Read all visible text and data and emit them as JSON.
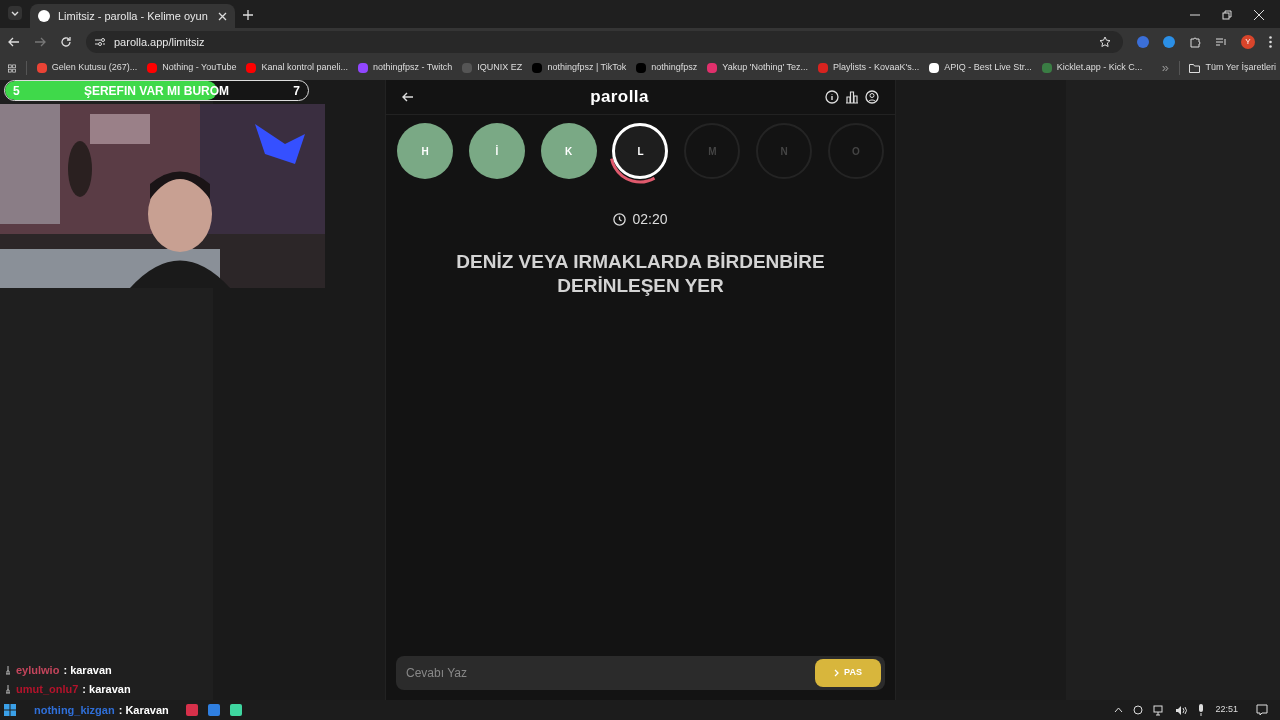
{
  "browser": {
    "tab": {
      "title": "Limitsiz - parolla - Kelime oyun",
      "selected": true
    },
    "address": "parolla.app/limitsiz",
    "bookmarks": [
      {
        "label": "Gelen Kutusu (267)...",
        "color": "#ea4335"
      },
      {
        "label": "Nothing - YouTube",
        "color": "#ff0000"
      },
      {
        "label": "Kanal kontrol paneli...",
        "color": "#ff0000"
      },
      {
        "label": "nothingfpsz - Twitch",
        "color": "#9146ff"
      },
      {
        "label": "IQUNIX EZ",
        "color": "#555555"
      },
      {
        "label": "nothingfpsz | TikTok",
        "color": "#000000"
      },
      {
        "label": "nothingfpsz",
        "color": "#000000"
      },
      {
        "label": "Yakup 'Nothing' Tez...",
        "color": "#e1306c"
      },
      {
        "label": "Playlists - KovaaK's...",
        "color": "#d8231f"
      },
      {
        "label": "APIQ - Best Live Str...",
        "color": "#ffffff"
      },
      {
        "label": "Kicklet.app - Kick C...",
        "color": "#3a7d44"
      }
    ],
    "all_bookmarks": "Tüm Yer İşaretleri",
    "profile": "Y"
  },
  "goal_bar": {
    "start": "5",
    "title": "ŞEREFIN VAR MI BUROM",
    "end": "7",
    "level": 0.7
  },
  "game": {
    "title": "parolla",
    "letters": [
      {
        "letter": "H",
        "kind": "correct"
      },
      {
        "letter": "İ",
        "kind": "correct"
      },
      {
        "letter": "K",
        "kind": "correct"
      },
      {
        "letter": "L",
        "kind": "current"
      },
      {
        "letter": "M",
        "kind": "pending"
      },
      {
        "letter": "N",
        "kind": "pending"
      },
      {
        "letter": "O",
        "kind": "pending"
      }
    ],
    "timer": "02:20",
    "question": "DENİZ VEYA IRMAKLARDA BİRDENBİRE DERİNLEŞEN YER",
    "answer": {
      "placeholder": "Cevabı Yaz"
    },
    "pass_button": "PAS"
  },
  "chat": [
    {
      "user": "eylulwio",
      "color": "#c4455c",
      "message": ": karavan"
    },
    {
      "user": "umut_onlu7",
      "color": "#b3132b",
      "message": ": karavan"
    },
    {
      "user": "nothing_kizgan",
      "color": "#2f6fd8",
      "message": ": Karavan"
    }
  ],
  "taskbar": {
    "time": "22:51"
  }
}
